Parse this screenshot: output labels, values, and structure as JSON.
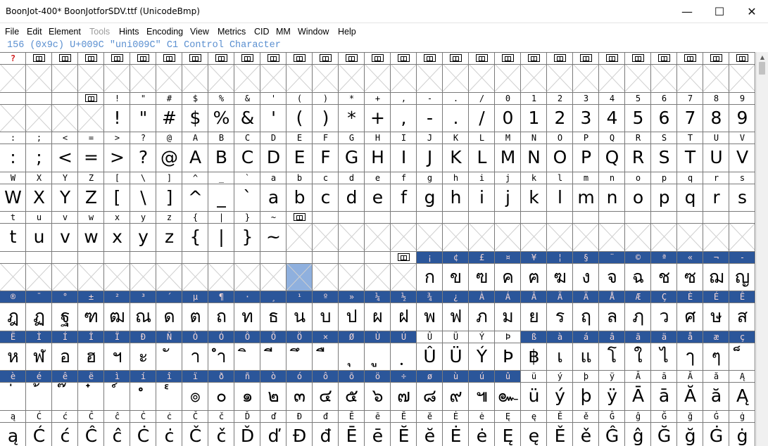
{
  "window": {
    "title": "BoonJot-400*  BoonJotforSDV.ttf (UnicodeBmp)",
    "minimize_glyph": "—",
    "maximize_glyph": "☐",
    "close_glyph": "✕"
  },
  "menu": [
    "File",
    "Edit",
    "Element",
    "Tools",
    "Hints",
    "Encoding",
    "View",
    "Metrics",
    "CID",
    "MM",
    "Window",
    "Help"
  ],
  "menu_disabled": [
    "Tools"
  ],
  "info": "156 (0x9c) U+009C \"uni009C\" C1 Control Character",
  "scrollbar": {
    "up_icon": "▲"
  },
  "colors": {
    "selection_label": "#2b569a",
    "selection_cell": "#8fb0de",
    "info_text": "#5a8fd0"
  },
  "rows": [
    {
      "labels": [
        "?",
        "■",
        "■",
        "■",
        "■",
        "■",
        "■",
        "■",
        "■",
        "■",
        "■",
        "■",
        "■",
        "■",
        "■",
        "■",
        "■",
        "■",
        "■",
        "■",
        "■",
        "■",
        "■",
        "■",
        "■",
        "■",
        "■",
        "■",
        "■"
      ],
      "glyphs": [
        "",
        "",
        "",
        "",
        "",
        "",
        "",
        "",
        "",
        "",
        "",
        "",
        "",
        "",
        "",
        "",
        "",
        "",
        "",
        "",
        "",
        "",
        "",
        "",
        "",
        "",
        "",
        "",
        ""
      ]
    },
    {
      "labels": [
        "",
        "",
        "",
        "■",
        "!",
        "\"",
        "#",
        "$",
        "%",
        "&",
        "'",
        "(",
        ")",
        "*",
        "+",
        ",",
        "-",
        ".",
        "/",
        "0",
        "1",
        "2",
        "3",
        "4",
        "5",
        "6",
        "7",
        "8",
        "9"
      ],
      "glyphs": [
        "",
        "",
        "",
        "",
        "!",
        "\"",
        "#",
        "$",
        "%",
        "&",
        "'",
        "(",
        ")",
        "*",
        "+",
        ",",
        "-",
        ".",
        "/",
        "0",
        "1",
        "2",
        "3",
        "4",
        "5",
        "6",
        "7",
        "8",
        "9"
      ]
    },
    {
      "labels": [
        ":",
        ";",
        "<",
        "=",
        ">",
        "?",
        "@",
        "A",
        "B",
        "C",
        "D",
        "E",
        "F",
        "G",
        "H",
        "I",
        "J",
        "K",
        "L",
        "M",
        "N",
        "O",
        "P",
        "Q",
        "R",
        "S",
        "T",
        "U",
        "V"
      ],
      "glyphs": [
        ":",
        ";",
        "<",
        "=",
        ">",
        "?",
        "@",
        "A",
        "B",
        "C",
        "D",
        "E",
        "F",
        "G",
        "H",
        "I",
        "J",
        "K",
        "L",
        "M",
        "N",
        "O",
        "P",
        "Q",
        "R",
        "S",
        "T",
        "U",
        "V"
      ]
    },
    {
      "labels": [
        "W",
        "X",
        "Y",
        "Z",
        "[",
        "\\",
        "]",
        "^",
        "_",
        "`",
        "a",
        "b",
        "c",
        "d",
        "e",
        "f",
        "g",
        "h",
        "i",
        "j",
        "k",
        "l",
        "m",
        "n",
        "o",
        "p",
        "q",
        "r",
        "s"
      ],
      "glyphs": [
        "W",
        "X",
        "Y",
        "Z",
        "[",
        "\\",
        "]",
        "^",
        "_",
        "`",
        "a",
        "b",
        "c",
        "d",
        "e",
        "f",
        "g",
        "h",
        "i",
        "j",
        "k",
        "l",
        "m",
        "n",
        "o",
        "p",
        "q",
        "r",
        "s"
      ]
    },
    {
      "labels": [
        "t",
        "u",
        "v",
        "w",
        "x",
        "y",
        "z",
        "{",
        "|",
        "}",
        "~",
        "■",
        "",
        "",
        "",
        "",
        "",
        "",
        "",
        "",
        "",
        "",
        "",
        "",
        "",
        "",
        "",
        "",
        ""
      ],
      "glyphs": [
        "t",
        "u",
        "v",
        "w",
        "x",
        "y",
        "z",
        "{",
        "|",
        "}",
        "~",
        "",
        "",
        "",
        "",
        "",
        "",
        "",
        "",
        "",
        "",
        "",
        "",
        "",
        "",
        "",
        "",
        "",
        ""
      ]
    },
    {
      "labels": [
        "",
        "",
        "",
        "",
        "",
        "",
        "",
        "",
        "",
        "",
        "",
        "",
        "",
        "",
        "",
        "■",
        "¡",
        "¢",
        "£",
        "¤",
        "¥",
        "¦",
        "§",
        "¨",
        "©",
        "ª",
        "«",
        "¬",
        "-"
      ],
      "glyphs": [
        "",
        "",
        "",
        "",
        "",
        "",
        "",
        "",
        "",
        "",
        "",
        "",
        "",
        "",
        "",
        "",
        "ก",
        "ข",
        "ฃ",
        "ค",
        "ฅ",
        "ฆ",
        "ง",
        "จ",
        "ฉ",
        "ช",
        "ซ",
        "ฌ",
        "ญ"
      ]
    },
    {
      "labels": [
        "®",
        "¯",
        "°",
        "±",
        "²",
        "³",
        "´",
        "µ",
        "¶",
        "·",
        "¸",
        "¹",
        "º",
        "»",
        "¼",
        "½",
        "¾",
        "¿",
        "À",
        "Á",
        "Â",
        "Ã",
        "Ä",
        "Å",
        "Æ",
        "Ç",
        "È",
        "É",
        "Ê"
      ],
      "glyphs": [
        "ฎ",
        "ฏ",
        "ฐ",
        "ฑ",
        "ฒ",
        "ณ",
        "ด",
        "ต",
        "ถ",
        "ท",
        "ธ",
        "น",
        "บ",
        "ป",
        "ผ",
        "ฝ",
        "พ",
        "ฟ",
        "ภ",
        "ม",
        "ย",
        "ร",
        "ฤ",
        "ล",
        "ฦ",
        "ว",
        "ศ",
        "ษ",
        "ส"
      ]
    },
    {
      "labels": [
        "Ë",
        "Ì",
        "Í",
        "Î",
        "Ï",
        "Ð",
        "Ñ",
        "Ò",
        "Ó",
        "Ô",
        "Õ",
        "Ö",
        "×",
        "Ø",
        "Ù",
        "Ú",
        "Û",
        "Ü",
        "Ý",
        "Þ",
        "ß",
        "à",
        "á",
        "â",
        "ã",
        "ä",
        "å",
        "æ",
        "ç"
      ],
      "glyphs": [
        "ห",
        "ฬ",
        "อ",
        "ฮ",
        "ฯ",
        "ะ",
        "ั",
        "า",
        "ำ",
        "ิ",
        "ี",
        "ึ",
        "ื",
        "ุ",
        "ู",
        "ฺ",
        "Û",
        "Ü",
        "Ý",
        "Þ",
        "฿",
        "เ",
        "แ",
        "โ",
        "ใ",
        "ไ",
        "ๅ",
        "ๆ",
        "็"
      ]
    },
    {
      "labels": [
        "è",
        "é",
        "ê",
        "ë",
        "ì",
        "í",
        "î",
        "ï",
        "ð",
        "ñ",
        "ò",
        "ó",
        "ô",
        "õ",
        "ö",
        "÷",
        "ø",
        "ù",
        "ú",
        "û",
        "ü",
        "ý",
        "þ",
        "ÿ",
        "Ā",
        "ā",
        "Ă",
        "ă",
        "Ą"
      ],
      "glyphs": [
        "่",
        "้",
        "๊",
        "๋",
        "์",
        "ํ",
        "๎",
        "๏",
        "๐",
        "๑",
        "๒",
        "๓",
        "๔",
        "๕",
        "๖",
        "๗",
        "๘",
        "๙",
        "๚",
        "๛",
        "ü",
        "ý",
        "þ",
        "ÿ",
        "Ā",
        "ā",
        "Ă",
        "ă",
        "Ą"
      ]
    },
    {
      "labels": [
        "ą",
        "Ć",
        "ć",
        "Ĉ",
        "ĉ",
        "Ċ",
        "ċ",
        "Č",
        "č",
        "Ď",
        "ď",
        "Đ",
        "đ",
        "Ē",
        "ē",
        "Ĕ",
        "ĕ",
        "Ė",
        "ė",
        "Ę",
        "ę",
        "Ě",
        "ě",
        "Ĝ",
        "ĝ",
        "Ğ",
        "ğ",
        "Ġ",
        "ġ"
      ],
      "glyphs": [
        "ą",
        "Ć",
        "ć",
        "Ĉ",
        "ĉ",
        "Ċ",
        "ċ",
        "Č",
        "č",
        "Ď",
        "ď",
        "Đ",
        "đ",
        "Ē",
        "ē",
        "Ĕ",
        "ĕ",
        "Ė",
        "ė",
        "Ę",
        "ę",
        "Ě",
        "ě",
        "Ĝ",
        "ĝ",
        "Ğ",
        "ğ",
        "Ġ",
        "ġ"
      ]
    }
  ],
  "selected_cells": [
    {
      "row": 5,
      "col": 11,
      "part": "glyph"
    }
  ],
  "selected_labels": [
    {
      "row": 5,
      "from": 16,
      "to": 28
    },
    {
      "row": 6,
      "from": 0,
      "to": 28
    },
    {
      "row": 7,
      "from": 0,
      "to": 15
    },
    {
      "row": 7,
      "from": 20,
      "to": 28
    },
    {
      "row": 8,
      "from": 0,
      "to": 19
    }
  ]
}
